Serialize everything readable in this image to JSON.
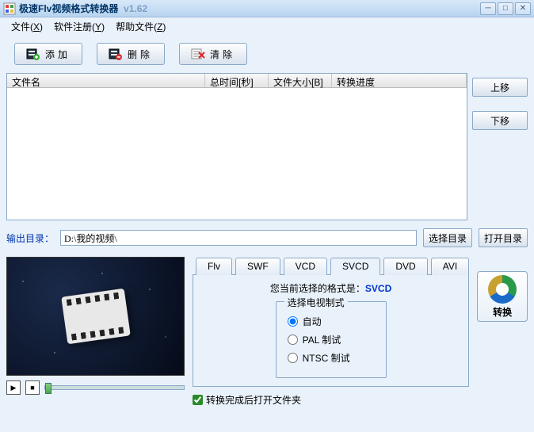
{
  "title": {
    "name": "极速Flv视频格式转换器",
    "version": "v1.62"
  },
  "menubar": [
    {
      "label": "文件",
      "hotkey": "X"
    },
    {
      "label": "软件注册",
      "hotkey": "Y"
    },
    {
      "label": "帮助文件",
      "hotkey": "Z"
    }
  ],
  "toolbar": {
    "add": "添加",
    "del": "删除",
    "clear": "清除"
  },
  "list": {
    "columns": [
      "文件名",
      "总时间[秒]",
      "文件大小[B]",
      "转换进度"
    ]
  },
  "sidebuttons": {
    "up": "上移",
    "down": "下移"
  },
  "output": {
    "label": "输出目录：",
    "path": "D:\\我的视频\\",
    "choose": "选择目录",
    "open": "打开目录"
  },
  "format": {
    "tabs": [
      "Flv",
      "SWF",
      "VCD",
      "SVCD",
      "DVD",
      "AVI"
    ],
    "current_prefix": "您当前选择的格式是：",
    "current_value": "SVCD",
    "group_label": "选择电视制式",
    "options": [
      "自动",
      "PAL 制试",
      "NTSC 制试"
    ],
    "selected": 0
  },
  "open_after": "转换完成后打开文件夹",
  "convert_label": "转换"
}
